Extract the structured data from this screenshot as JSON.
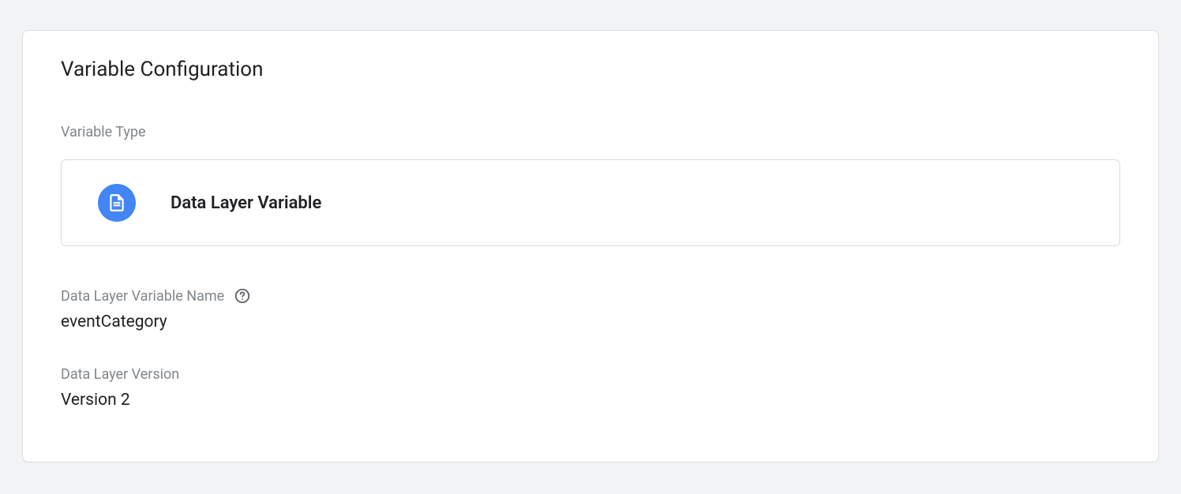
{
  "card": {
    "title": "Variable Configuration",
    "variableType": {
      "label": "Variable Type",
      "selected": "Data Layer Variable"
    },
    "fields": {
      "dataLayerVariableName": {
        "label": "Data Layer Variable Name",
        "value": "eventCategory"
      },
      "dataLayerVersion": {
        "label": "Data Layer Version",
        "value": "Version 2"
      }
    }
  }
}
